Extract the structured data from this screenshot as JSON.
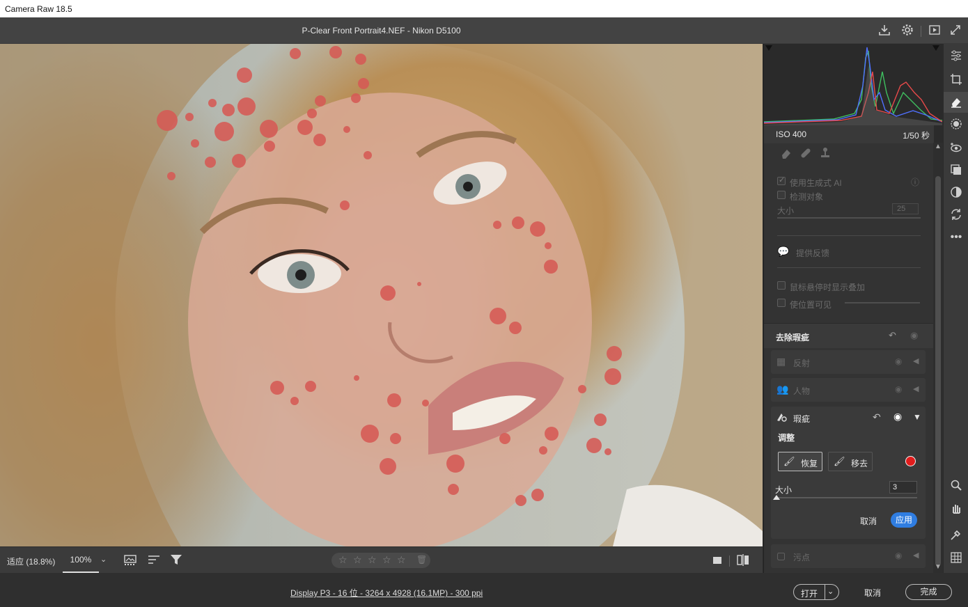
{
  "os": {
    "title": "Camera Raw 18.5"
  },
  "header": {
    "title": "P-Clear Front Portrait4.NEF -  Nikon D5100",
    "icons": [
      "save-icon",
      "gear-icon",
      "slideshow-icon",
      "fullscreen-icon"
    ]
  },
  "canvas_toolbar": {
    "zoom_fit": "适应 (18.8%)",
    "zoom_100": "100%",
    "rating_stars": 5
  },
  "status": {
    "image_info": "Display P3 - 16 位 - 3264 x 4928 (16.1MP) - 300 ppi",
    "open_label": "打开",
    "cancel_label": "取消",
    "done_label": "完成"
  },
  "histogram": {
    "iso": "ISO 400",
    "shutter": "1/50 秒"
  },
  "heal_panel": {
    "use_gen_ai": "使用生成式 AI",
    "detect_objects": "检测对象",
    "size_label": "大小",
    "size_value": "25",
    "feedback": "提供反馈",
    "show_overlay": "鼠标悬停时显示叠加",
    "visualize_spots": "使位置可见"
  },
  "distraction": {
    "section_title": "去除瑕疵",
    "items": [
      {
        "label": "反射"
      },
      {
        "label": "人物"
      }
    ],
    "blemish": {
      "label": "瑕疵",
      "adjust_label": "调整",
      "restore_label": "恢复",
      "remove_label": "移去",
      "size_label": "大小",
      "size_value": "3",
      "size_fraction": 0.01,
      "cancel_label": "取消",
      "apply_label": "应用",
      "brush_color": "#e11c1c"
    },
    "dust": {
      "label": "污点"
    }
  },
  "colors": {
    "accent": "#2f7de1",
    "overlay": "#d9534f"
  }
}
